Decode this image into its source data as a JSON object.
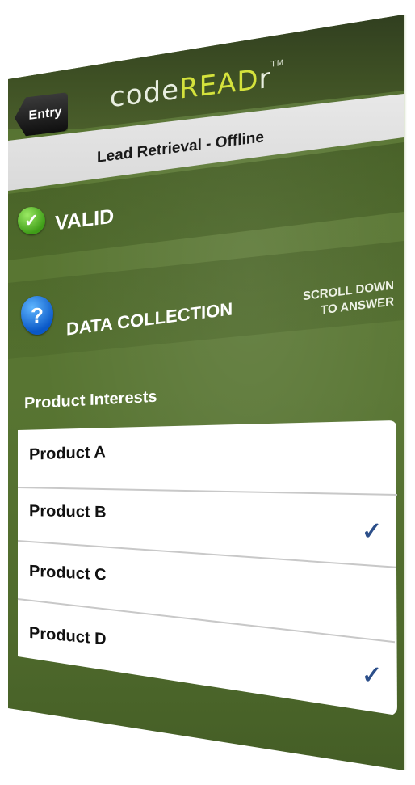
{
  "header": {
    "back_label": "Entry",
    "logo_prefix": "code",
    "logo_accent": "READ",
    "logo_suffix": "r",
    "trademark": "TM",
    "subtitle": "Lead Retrieval - Offline"
  },
  "status": {
    "valid_label": "VALID"
  },
  "data_collection": {
    "title": "DATA COLLECTION",
    "hint_line1": "SCROLL DOWN",
    "hint_line2": "TO ANSWER"
  },
  "product_interests": {
    "label": "Product Interests",
    "items": [
      {
        "label": "Product A",
        "checked": false
      },
      {
        "label": "Product B",
        "checked": true
      },
      {
        "label": "Product C",
        "checked": false
      },
      {
        "label": "Product D",
        "checked": true
      }
    ],
    "check_glyph": "✓"
  },
  "colors": {
    "background_green": "#587532",
    "logo_accent": "#d4e23c",
    "check_blue": "#2c4f8a"
  }
}
